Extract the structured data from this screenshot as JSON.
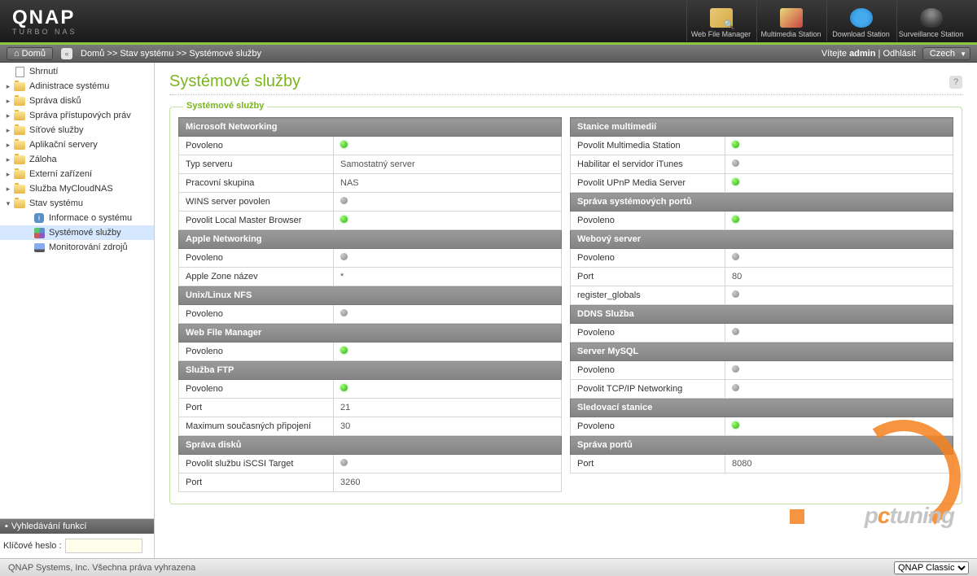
{
  "brand": {
    "name": "QNAP",
    "tagline": "TURBO NAS"
  },
  "header_apps": [
    {
      "label": "Web File Manager",
      "icon": "file"
    },
    {
      "label": "Multimedia Station",
      "icon": "multimedia"
    },
    {
      "label": "Download Station",
      "icon": "download"
    },
    {
      "label": "Surveillance Station",
      "icon": "surveillance"
    }
  ],
  "breadcrumb": {
    "home": "Domů",
    "path": [
      "Domů",
      "Stav systému",
      "Systémové služby"
    ],
    "sep": " >> ",
    "welcome_prefix": "Vítejte ",
    "user": "admin",
    "logout": "Odhlásit",
    "language": "Czech"
  },
  "sidebar": {
    "items": [
      {
        "label": "Shrnutí",
        "icon": "page"
      },
      {
        "label": "Adinistrace systému",
        "icon": "folder",
        "exp": true
      },
      {
        "label": "Správa disků",
        "icon": "folder",
        "exp": true
      },
      {
        "label": "Správa přístupových práv",
        "icon": "folder",
        "exp": true
      },
      {
        "label": "Síťové služby",
        "icon": "folder",
        "exp": true
      },
      {
        "label": "Aplikační servery",
        "icon": "folder",
        "exp": true
      },
      {
        "label": "Záloha",
        "icon": "folder",
        "exp": true
      },
      {
        "label": "Externí zařízení",
        "icon": "folder",
        "exp": true
      },
      {
        "label": "Služba MyCloudNAS",
        "icon": "folder",
        "exp": true
      },
      {
        "label": "Stav systému",
        "icon": "folder",
        "exp": true,
        "open": true,
        "children": [
          {
            "label": "Informace o systému",
            "icon": "info"
          },
          {
            "label": "Systémové služby",
            "icon": "svc",
            "selected": true
          },
          {
            "label": "Monitorování zdrojů",
            "icon": "mon"
          }
        ]
      }
    ],
    "search": {
      "title": "Vyhledávání funkcí",
      "label": "Klíčové heslo :",
      "value": ""
    }
  },
  "page": {
    "title": "Systémové služby",
    "fieldset_title": "Systémové služby"
  },
  "tables": {
    "left": [
      {
        "section": "Microsoft Networking"
      },
      {
        "label": "Povoleno",
        "status": "green"
      },
      {
        "label": "Typ serveru",
        "value": "Samostatný server"
      },
      {
        "label": "Pracovní skupina",
        "value": "NAS"
      },
      {
        "label": "WINS server povolen",
        "status": "gray"
      },
      {
        "label": "Povolit Local Master Browser",
        "status": "green"
      },
      {
        "section": "Apple Networking"
      },
      {
        "label": "Povoleno",
        "status": "gray"
      },
      {
        "label": "Apple Zone název",
        "value": "*"
      },
      {
        "section": "Unix/Linux NFS"
      },
      {
        "label": "Povoleno",
        "status": "gray"
      },
      {
        "section": "Web File Manager"
      },
      {
        "label": "Povoleno",
        "status": "green"
      },
      {
        "section": "Služba FTP"
      },
      {
        "label": "Povoleno",
        "status": "green"
      },
      {
        "label": "Port",
        "value": "21"
      },
      {
        "label": "Maximum současných připojení",
        "value": "30"
      },
      {
        "section": "Správa disků"
      },
      {
        "label": "Povolit službu iSCSI Target",
        "status": "gray"
      },
      {
        "label": "Port",
        "value": "3260"
      }
    ],
    "right": [
      {
        "section": "Stanice multimedií"
      },
      {
        "label": "Povolit Multimedia Station",
        "status": "green"
      },
      {
        "label": "Habilitar el servidor iTunes",
        "status": "gray"
      },
      {
        "label": "Povolit UPnP Media Server",
        "status": "green"
      },
      {
        "section": "Správa systémových portů"
      },
      {
        "label": "Povoleno",
        "status": "green"
      },
      {
        "section": "Webový server"
      },
      {
        "label": "Povoleno",
        "status": "gray"
      },
      {
        "label": "Port",
        "value": "80"
      },
      {
        "label": "register_globals",
        "status": "gray"
      },
      {
        "section": "DDNS Služba"
      },
      {
        "label": "Povoleno",
        "status": "gray"
      },
      {
        "section": "Server MySQL"
      },
      {
        "label": "Povoleno",
        "status": "gray"
      },
      {
        "label": "Povolit TCP/IP Networking",
        "status": "gray"
      },
      {
        "section": "Sledovací stanice"
      },
      {
        "label": "Povoleno",
        "status": "green"
      },
      {
        "section": "Správa portů"
      },
      {
        "label": "Port",
        "value": "8080"
      }
    ]
  },
  "footer": {
    "copyright": "QNAP Systems, Inc. Všechna práva vyhrazena",
    "theme": "QNAP Classic"
  },
  "watermark": "pctuning"
}
